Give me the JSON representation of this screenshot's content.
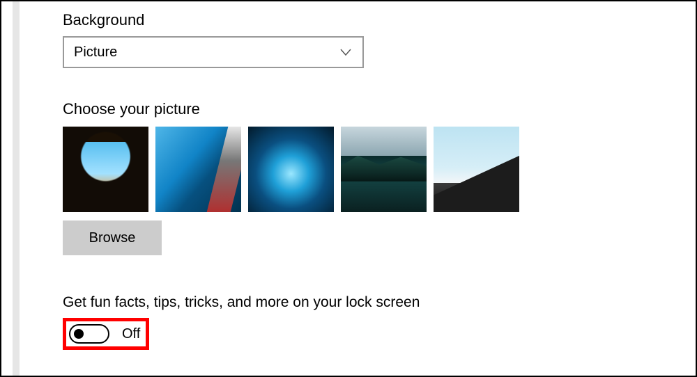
{
  "background": {
    "label": "Background",
    "selected": "Picture"
  },
  "choose_picture": {
    "heading": "Choose your picture",
    "browse_label": "Browse"
  },
  "fun_facts": {
    "label": "Get fun facts, tips, tricks, and more on your lock screen",
    "state_text": "Off"
  }
}
